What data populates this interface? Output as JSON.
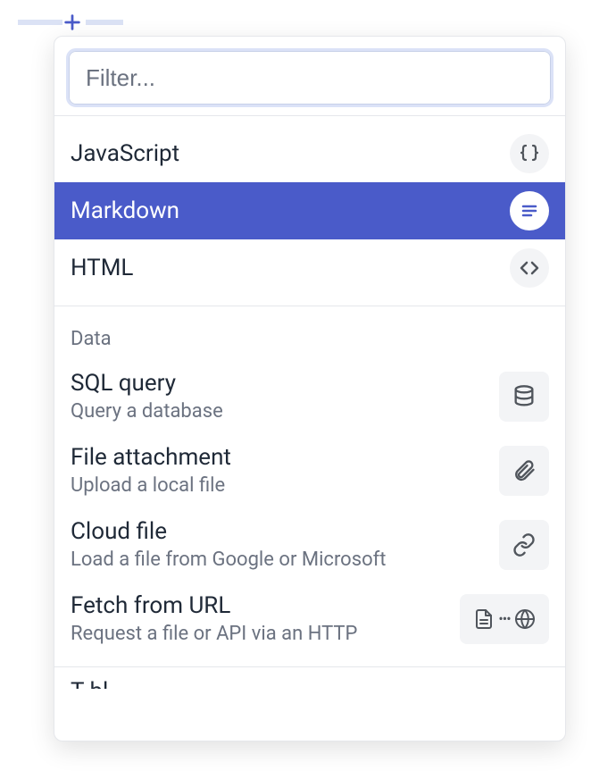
{
  "filter_placeholder": "Filter...",
  "top": {
    "items": [
      {
        "label": "JavaScript",
        "icon": "braces",
        "selected": false
      },
      {
        "label": "Markdown",
        "icon": "text-lines",
        "selected": true
      },
      {
        "label": "HTML",
        "icon": "code-brackets",
        "selected": false
      }
    ]
  },
  "sections": [
    {
      "header": "Data",
      "items": [
        {
          "title": "SQL query",
          "desc": "Query a database",
          "icon": "database"
        },
        {
          "title": "File attachment",
          "desc": "Upload a local file",
          "icon": "paperclip"
        },
        {
          "title": "Cloud file",
          "desc": "Load a file from Google or Microsoft",
          "icon": "link"
        },
        {
          "title": "Fetch from URL",
          "desc": "Request a file or API via an HTTP",
          "icon": "fetch-combo"
        }
      ]
    }
  ],
  "cutoff_hint": "T bl"
}
